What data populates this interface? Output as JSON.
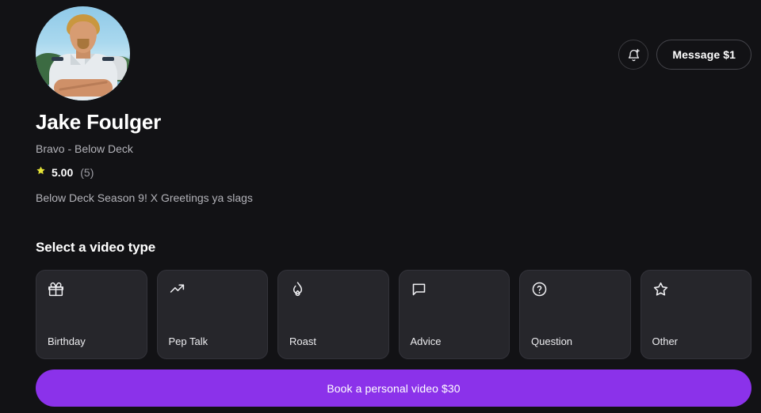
{
  "colors": {
    "background": "#121215",
    "card_background": "#26262b",
    "card_border": "#33333a",
    "accent_purple": "#8b32ea",
    "star_yellow": "#e5e337",
    "text_primary": "#ffffff",
    "text_secondary": "#b3b3b9"
  },
  "header": {
    "notify_icon": "bell-plus-icon",
    "message_label": "Message $1"
  },
  "profile": {
    "avatar_icon": "avatar",
    "name": "Jake Foulger",
    "channel": "Bravo - Below Deck",
    "star_icon": "star-icon",
    "rating_value": "5.00",
    "rating_count": "(5)",
    "bio": "Below Deck Season 9! X Greetings ya slags"
  },
  "video_types": {
    "title": "Select a video type",
    "options": [
      {
        "label": "Birthday",
        "icon": "gift-icon"
      },
      {
        "label": "Pep Talk",
        "icon": "trending-up-icon"
      },
      {
        "label": "Roast",
        "icon": "flame-icon"
      },
      {
        "label": "Advice",
        "icon": "speech-bubble-icon"
      },
      {
        "label": "Question",
        "icon": "question-circle-icon"
      },
      {
        "label": "Other",
        "icon": "star-outline-icon"
      }
    ]
  },
  "cta": {
    "label": "Book a personal video $30"
  }
}
